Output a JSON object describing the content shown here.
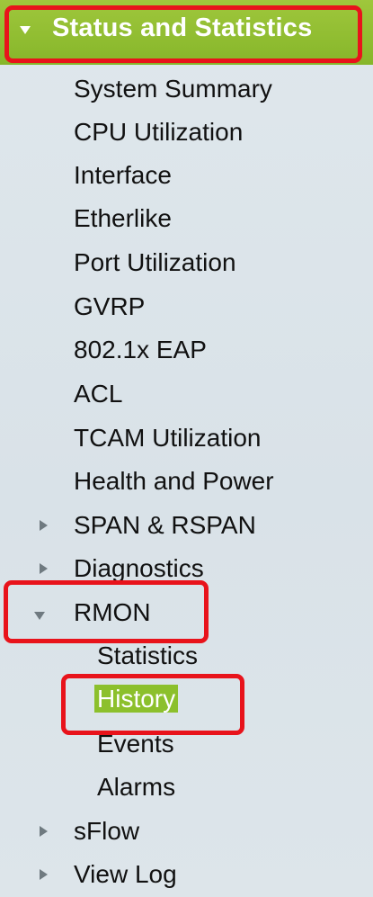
{
  "header": {
    "title": "Status and Statistics"
  },
  "menu": {
    "items": [
      {
        "label": "System Summary"
      },
      {
        "label": "CPU Utilization"
      },
      {
        "label": "Interface"
      },
      {
        "label": "Etherlike"
      },
      {
        "label": "Port Utilization"
      },
      {
        "label": "GVRP"
      },
      {
        "label": "802.1x EAP"
      },
      {
        "label": "ACL"
      },
      {
        "label": "TCAM Utilization"
      },
      {
        "label": "Health and Power"
      },
      {
        "label": "SPAN & RSPAN"
      },
      {
        "label": "Diagnostics"
      },
      {
        "label": "RMON"
      },
      {
        "label": "sFlow"
      },
      {
        "label": "View Log"
      }
    ],
    "rmon_children": [
      {
        "label": "Statistics"
      },
      {
        "label": "History"
      },
      {
        "label": "Events"
      },
      {
        "label": "Alarms"
      }
    ]
  },
  "colors": {
    "header_green": "#8cc02c",
    "highlight_red": "#e8131b",
    "selected_bg": "#8cc02c"
  }
}
